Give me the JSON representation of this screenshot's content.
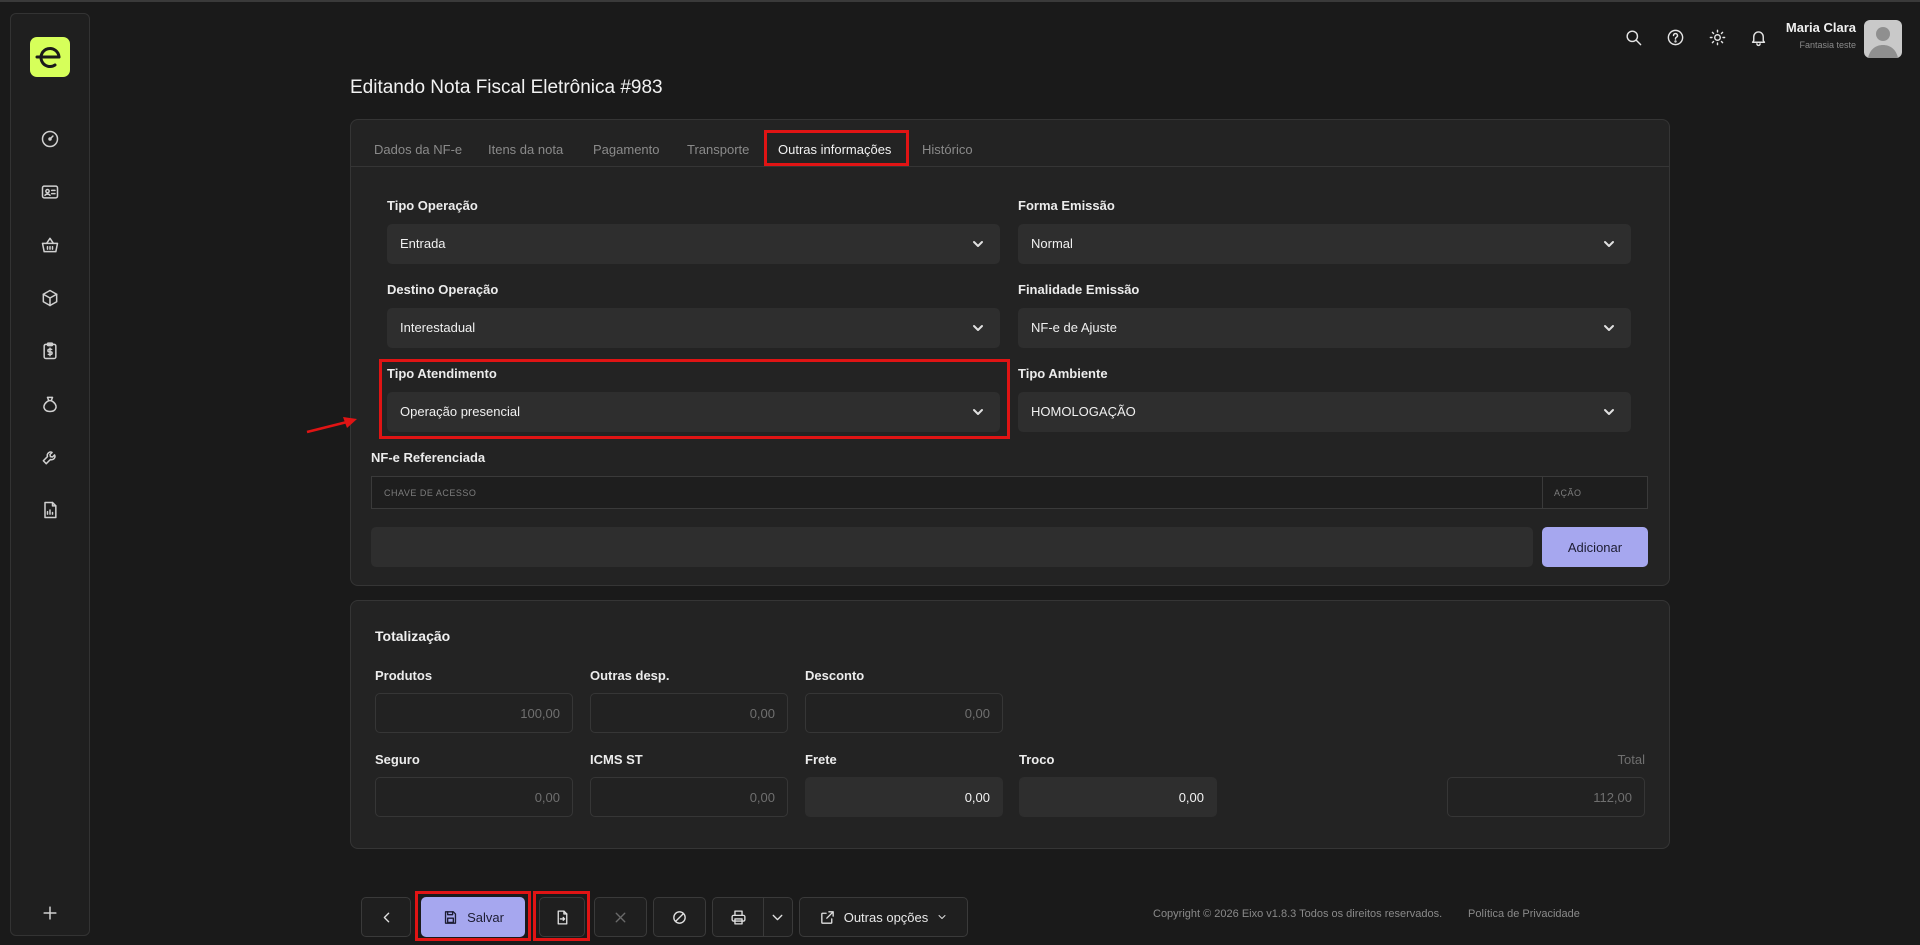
{
  "app": {
    "logo_letter": "e"
  },
  "sidebar": {
    "items": [
      {
        "icon": "gauge-icon"
      },
      {
        "icon": "id-card-icon"
      },
      {
        "icon": "basket-icon"
      },
      {
        "icon": "box-icon"
      },
      {
        "icon": "clipboard-dollar-icon"
      },
      {
        "icon": "money-bag-icon"
      },
      {
        "icon": "wrench-icon"
      },
      {
        "icon": "report-icon"
      }
    ],
    "add_icon": "plus-icon"
  },
  "topbar": {
    "icons": [
      "search-icon",
      "help-icon",
      "sun-icon",
      "bell-icon"
    ],
    "user_name": "Maria Clara",
    "user_sub": "Fantasia teste"
  },
  "page": {
    "title": "Editando Nota Fiscal Eletrônica #983"
  },
  "tabs": [
    {
      "label": "Dados da NF-e",
      "active": false
    },
    {
      "label": "Itens da nota",
      "active": false
    },
    {
      "label": "Pagamento",
      "active": false
    },
    {
      "label": "Transporte",
      "active": false
    },
    {
      "label": "Outras informações",
      "active": true
    },
    {
      "label": "Histórico",
      "active": false
    }
  ],
  "form": {
    "tipo_operacao": {
      "label": "Tipo Operação",
      "value": "Entrada"
    },
    "forma_emissao": {
      "label": "Forma Emissão",
      "value": "Normal"
    },
    "destino_operacao": {
      "label": "Destino Operação",
      "value": "Interestadual"
    },
    "finalidade_emissao": {
      "label": "Finalidade Emissão",
      "value": "NF-e de Ajuste"
    },
    "tipo_atendimento": {
      "label": "Tipo Atendimento",
      "value": "Operação presencial"
    },
    "tipo_ambiente": {
      "label": "Tipo Ambiente",
      "value": "HOMOLOGAÇÃO"
    }
  },
  "referenciada": {
    "title": "NF-e Referenciada",
    "col_chave": "CHAVE DE ACESSO",
    "col_acao": "AÇÃO",
    "input_value": "",
    "add_label": "Adicionar"
  },
  "totalizacao": {
    "title": "Totalização",
    "produtos": {
      "label": "Produtos",
      "value": "100,00"
    },
    "outras_desp": {
      "label": "Outras desp.",
      "value": "0,00"
    },
    "desconto": {
      "label": "Desconto",
      "value": "0,00"
    },
    "seguro": {
      "label": "Seguro",
      "value": "0,00"
    },
    "icms_st": {
      "label": "ICMS ST",
      "value": "0,00"
    },
    "frete": {
      "label": "Frete",
      "value": "0,00"
    },
    "troco": {
      "label": "Troco",
      "value": "0,00"
    },
    "total": {
      "label": "Total",
      "value": "112,00"
    }
  },
  "toolbar": {
    "save_label": "Salvar",
    "more_label": "Outras opções"
  },
  "footer": {
    "copyright": "Copyright © 2026 Eixo v1.8.3 Todos os direitos reservados.",
    "privacy": "Política de Privacidade"
  },
  "colors": {
    "accent": "#a6a7ef",
    "logo": "#d6ff5a",
    "highlight": "#e01414",
    "background": "#1a1a1a"
  }
}
